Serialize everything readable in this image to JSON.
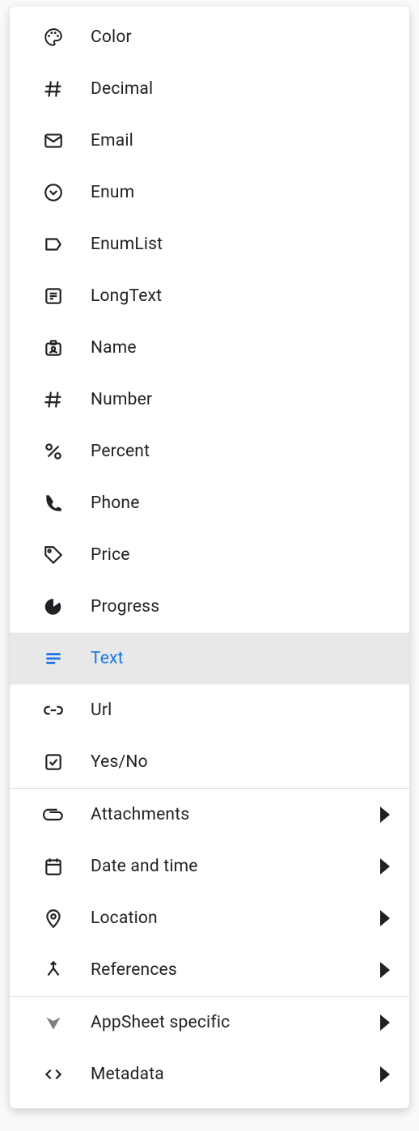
{
  "menu": {
    "simple_group": [
      {
        "id": "color",
        "label": "Color",
        "icon": "palette-icon"
      },
      {
        "id": "decimal",
        "label": "Decimal",
        "icon": "hash-icon"
      },
      {
        "id": "email",
        "label": "Email",
        "icon": "mail-icon"
      },
      {
        "id": "enum",
        "label": "Enum",
        "icon": "circle-dot-icon"
      },
      {
        "id": "enumlist",
        "label": "EnumList",
        "icon": "label-icon"
      },
      {
        "id": "longtext",
        "label": "LongText",
        "icon": "notes-icon"
      },
      {
        "id": "name",
        "label": "Name",
        "icon": "id-badge-icon"
      },
      {
        "id": "number",
        "label": "Number",
        "icon": "hash-icon"
      },
      {
        "id": "percent",
        "label": "Percent",
        "icon": "percent-icon"
      },
      {
        "id": "phone",
        "label": "Phone",
        "icon": "phone-icon"
      },
      {
        "id": "price",
        "label": "Price",
        "icon": "price-tag-icon"
      },
      {
        "id": "progress",
        "label": "Progress",
        "icon": "pie-chart-icon"
      },
      {
        "id": "text",
        "label": "Text",
        "icon": "text-lines-icon",
        "selected": true
      },
      {
        "id": "url",
        "label": "Url",
        "icon": "link-icon"
      },
      {
        "id": "yesno",
        "label": "Yes/No",
        "icon": "checkbox-icon"
      }
    ],
    "sub_group_1": [
      {
        "id": "attachments",
        "label": "Attachments",
        "icon": "attachment-icon"
      },
      {
        "id": "datetime",
        "label": "Date and time",
        "icon": "calendar-icon"
      },
      {
        "id": "location",
        "label": "Location",
        "icon": "location-icon"
      },
      {
        "id": "references",
        "label": "References",
        "icon": "merge-icon"
      }
    ],
    "sub_group_2": [
      {
        "id": "appsheet",
        "label": "AppSheet specific",
        "icon": "appsheet-icon"
      },
      {
        "id": "metadata",
        "label": "Metadata",
        "icon": "code-icon"
      }
    ]
  },
  "colors": {
    "selected_text": "#1a73e8",
    "selected_bg": "#e8e8e8",
    "text": "#202124"
  }
}
